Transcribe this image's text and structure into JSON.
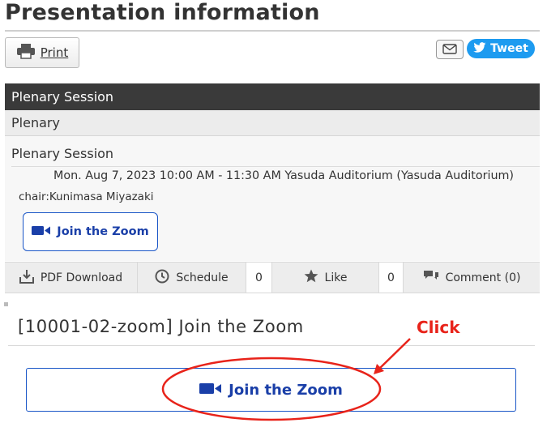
{
  "page": {
    "title": "Presentation information"
  },
  "toolbar": {
    "print_label": "Print",
    "print_icon": "printer-icon",
    "mail_icon": "envelope-icon",
    "tweet_label": "Tweet",
    "tweet_icon": "twitter-bird-icon"
  },
  "session": {
    "header": "Plenary Session",
    "category": "Plenary",
    "name": "Plenary Session",
    "datetime_location": "Mon. Aug 7, 2023 10:00 AM - 11:30 AM Yasuda Auditorium (Yasuda Auditorium)",
    "chair": "chair:Kunimasa Miyazaki",
    "zoom_button": "Join the Zoom",
    "zoom_icon": "video-camera-icon"
  },
  "actions": {
    "pdf_download": "PDF Download",
    "schedule": "Schedule",
    "schedule_count": "0",
    "like": "Like",
    "like_count": "0",
    "comment": "Comment (0)"
  },
  "zoom_section": {
    "heading": "[10001-02-zoom] Join the Zoom",
    "button": "Join the Zoom"
  },
  "annotation": {
    "label": "Click",
    "color": "#e8231a"
  },
  "colors": {
    "header_bg": "#3a3a3a",
    "zoom_blue": "#1a56c7",
    "tweet_blue": "#1d9bf0"
  }
}
